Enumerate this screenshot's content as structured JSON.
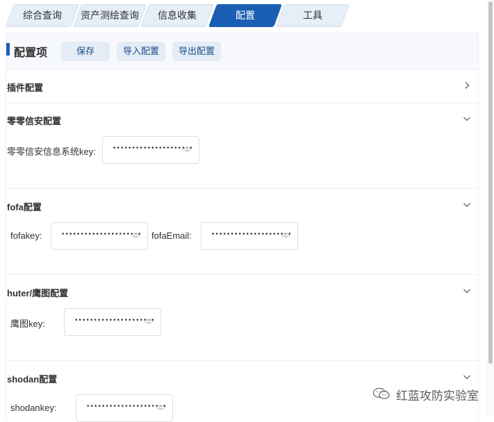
{
  "tabs": [
    {
      "label": "综合查询"
    },
    {
      "label": "资产测绘查询"
    },
    {
      "label": "信息收集"
    },
    {
      "label": "配置"
    },
    {
      "label": "工具"
    }
  ],
  "header": {
    "title": "配置项",
    "save_label": "保存",
    "import_label": "导入配置",
    "export_label": "导出配置"
  },
  "sections": {
    "plugin": {
      "title": "插件配置"
    },
    "lingling": {
      "title": "零零信安配置",
      "fields": [
        {
          "label": "零零信安信息系统key:",
          "value": "•••••••••••••••••••••"
        }
      ]
    },
    "fofa": {
      "title": "fofa配置",
      "fields": [
        {
          "label": "fofakey:",
          "value": "•••••••••••••••••••••"
        },
        {
          "label": "fofaEmail:",
          "value": "•••••••••••••••••••••"
        }
      ]
    },
    "hunter": {
      "title": "huter/鹰图配置",
      "fields": [
        {
          "label": "鹰图key:",
          "value": "•••••••••••••••••••••"
        }
      ]
    },
    "shodan": {
      "title": "shodan配置",
      "fields": [
        {
          "label": "shodankey:",
          "value": "•••••••••••••••••••••"
        }
      ]
    }
  },
  "watermark": {
    "text": "红蓝攻防实验室"
  },
  "colors": {
    "accent": "#1a5fb4",
    "tab_inactive": "#e6eef7",
    "button_bg": "#e4ecf5"
  }
}
